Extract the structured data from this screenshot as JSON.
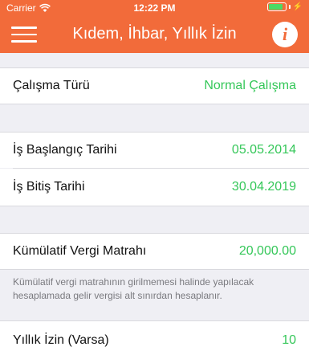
{
  "status_bar": {
    "carrier": "Carrier",
    "time": "12:22 PM",
    "battery_color": "#4cd964"
  },
  "nav": {
    "title": "Kıdem, İhbar, Yıllık İzin",
    "menu_icon": "hamburger-icon",
    "info_icon": "info-icon",
    "info_glyph": "i",
    "accent_color": "#f26b3a"
  },
  "rows": {
    "work_type": {
      "label": "Çalışma Türü",
      "value": "Normal Çalışma"
    },
    "start_date": {
      "label": "İş Başlangıç Tarihi",
      "value": "05.05.2014"
    },
    "end_date": {
      "label": "İş Bitiş Tarihi",
      "value": "30.04.2019"
    },
    "cumulative_tax_base": {
      "label": "Kümülatif Vergi Matrahı",
      "value": "20,000.00"
    },
    "annual_leave": {
      "label": "Yıllık İzin (Varsa)",
      "value": "10"
    }
  },
  "footnote": "Kümülatif vergi matrahının girilmemesi halinde yapılacak hesaplamada gelir vergisi alt sınırdan hesaplanır.",
  "value_color": "#35c759"
}
